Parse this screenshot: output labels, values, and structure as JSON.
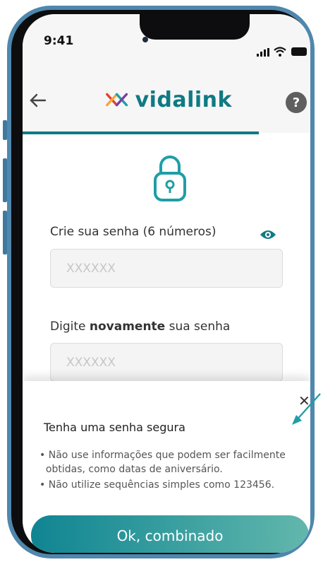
{
  "status_bar": {
    "time": "9:41"
  },
  "header": {
    "logo_text": "vidalink",
    "help_label": "?"
  },
  "form": {
    "password_label": "Crie sua senha (6 números)",
    "password_placeholder": "XXXXXX",
    "confirm_label_prefix": "Digite ",
    "confirm_label_bold": "novamente",
    "confirm_label_suffix": " sua senha",
    "confirm_placeholder": "XXXXXX"
  },
  "sheet": {
    "close_label": "✕",
    "title": "Tenha uma senha segura",
    "tip1_line1": "Não use informações que podem ser facilmente",
    "tip1_line2": "obtidas, como datas de aniversário.",
    "tip2": "Não utilize sequências simples como 123456.",
    "button_label": "Ok, combinado"
  },
  "colors": {
    "brand": "#0f7a83",
    "button_start": "#0f8592",
    "button_end": "#62b7ac"
  },
  "icons": {
    "back": "arrow-left",
    "help": "question",
    "lock": "padlock",
    "eye": "eye",
    "close": "close-x"
  }
}
